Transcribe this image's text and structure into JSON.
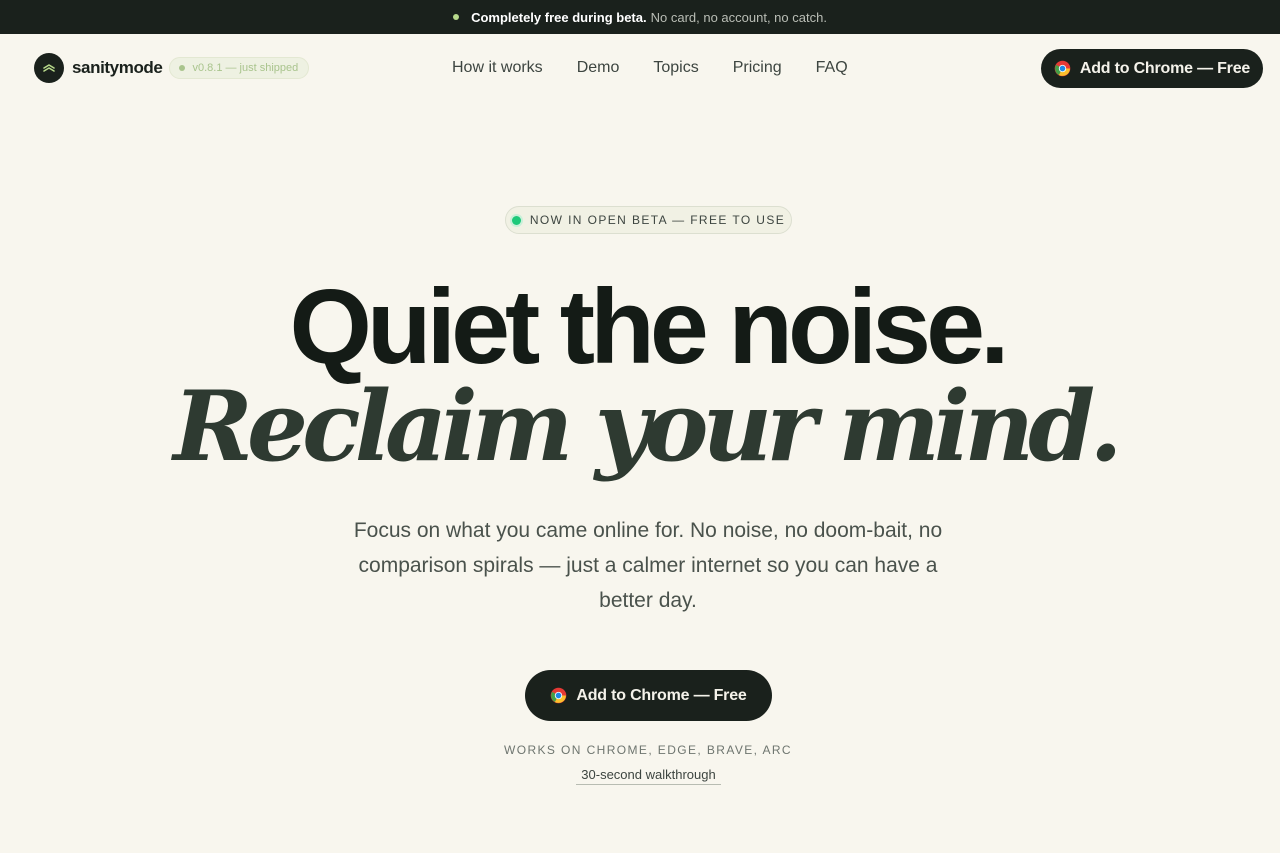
{
  "announcement": {
    "bold_text": "Completely free during beta.",
    "text": "No card, no account, no catch."
  },
  "brand": {
    "name": "sanitymode",
    "version_badge": "v0.8.1 — just shipped"
  },
  "nav": {
    "links": [
      "How it works",
      "Demo",
      "Topics",
      "Pricing",
      "FAQ"
    ],
    "cta_label": "Add to Chrome — Free"
  },
  "hero": {
    "badge": "NOW IN OPEN BETA — FREE TO USE",
    "headline": "Quiet the noise.",
    "subheadline": "Reclaim your mind.",
    "lede": "Focus on what you came online for. No noise, no doom-bait, no comparison spirals — just a calmer internet so you can have a better day.",
    "cta_label": "Add to Chrome — Free",
    "compatibility": "WORKS ON CHROME, EDGE, BRAVE, ARC",
    "walkthrough_link": "30-second walkthrough"
  },
  "icons": {
    "logo": "chevron-up-icon",
    "cta": "chrome-icon"
  },
  "colors": {
    "background": "#f8f6ee",
    "dark": "#1a211c",
    "beta_dot": "#1ec97a",
    "version_green": "#a9c48d"
  }
}
